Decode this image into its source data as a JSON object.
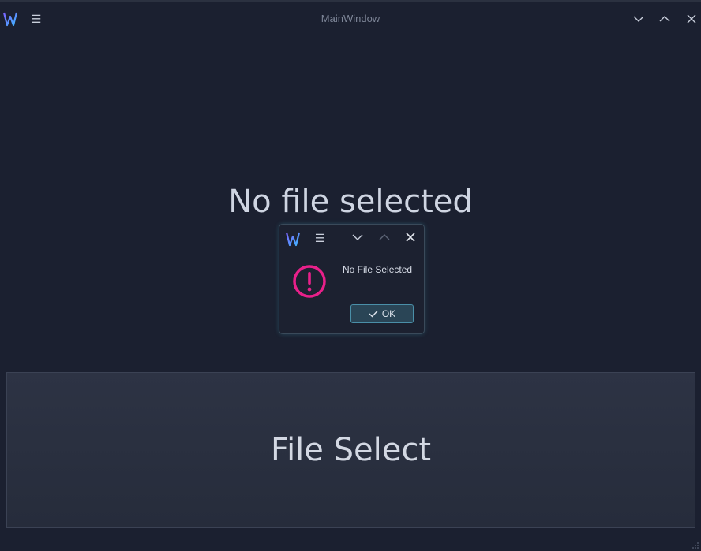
{
  "window": {
    "title": "MainWindow",
    "menu_icon": "hamburger-menu-icon",
    "logo_icon": "app-logo-icon",
    "buttons": [
      "minimize-icon",
      "maximize-icon",
      "close-icon"
    ]
  },
  "main": {
    "status_label": "No file selected",
    "file_select_label": "File Select"
  },
  "dialog": {
    "message": "No File Selected",
    "ok_label": "OK",
    "icon": "warning-icon",
    "icon_color": "#e8208a"
  },
  "colors": {
    "background": "#1b2030",
    "logo_gradient": [
      "#7b61ff",
      "#3fb6ff"
    ],
    "accent_border": "#4a8fa8"
  }
}
